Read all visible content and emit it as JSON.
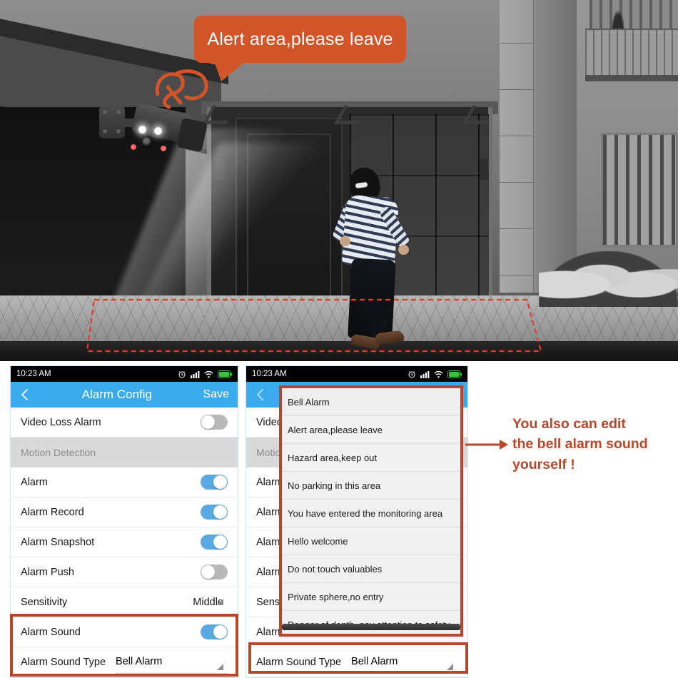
{
  "photo": {
    "speech_bubble": "Alert area,please leave",
    "scene_description": "security camera monitoring a house entrance with an intruder",
    "colors": {
      "bubble_bg": "#d2552a",
      "bubble_text": "#ffffff",
      "zone_line": "#e33a2a"
    },
    "icons": {
      "camera": "security-camera-icon",
      "doodle": "sound-wave-doodle-icon",
      "zone": "detection-zone-outline"
    }
  },
  "phone_left": {
    "statusbar": {
      "time": "10:23 AM",
      "icons": [
        "alarm-clock-icon",
        "signal-bars-icon",
        "wifi-icon",
        "battery-icon"
      ]
    },
    "navbar": {
      "back": "back-chevron-icon",
      "title": "Alarm Config",
      "save_label": "Save"
    },
    "rows": [
      {
        "type": "toggle",
        "label": "Video Loss Alarm",
        "value": "off"
      },
      {
        "type": "group",
        "label": "Motion Detection"
      },
      {
        "type": "toggle",
        "label": "Alarm",
        "value": "on"
      },
      {
        "type": "toggle",
        "label": "Alarm Record",
        "value": "on"
      },
      {
        "type": "toggle",
        "label": "Alarm Snapshot",
        "value": "on"
      },
      {
        "type": "toggle",
        "label": "Alarm Push",
        "value": "off"
      },
      {
        "type": "picker",
        "label": "Sensitivity",
        "value": "Middle"
      },
      {
        "type": "toggle",
        "label": "Alarm Sound",
        "value": "on"
      },
      {
        "type": "picker",
        "label": "Alarm Sound Type",
        "value": "Bell Alarm"
      }
    ]
  },
  "phone_right": {
    "statusbar": {
      "time": "10:23 AM",
      "icons": [
        "alarm-clock-icon",
        "signal-bars-icon",
        "wifi-icon",
        "battery-icon"
      ]
    },
    "navbar": {
      "back": "back-chevron-icon",
      "title": "Alarm Config",
      "save_label": "Save"
    },
    "rows": [
      {
        "type": "toggle",
        "label": "Video",
        "value": "off"
      },
      {
        "type": "group",
        "label": "Motion"
      },
      {
        "type": "toggle",
        "label": "Alarm",
        "value": "on"
      },
      {
        "type": "toggle",
        "label": "Alarm",
        "value": "on"
      },
      {
        "type": "toggle",
        "label": "Alarm",
        "value": "on"
      },
      {
        "type": "toggle",
        "label": "Alarm",
        "value": "off"
      },
      {
        "type": "picker",
        "label": "Sensit",
        "value": ""
      },
      {
        "type": "toggle",
        "label": "Alarm",
        "value": "on"
      }
    ],
    "bottom_field": {
      "label": "Alarm Sound Type",
      "value": "Bell Alarm"
    },
    "dropdown": {
      "selected": "Bell Alarm",
      "options": [
        "Bell Alarm",
        "Alert area,please leave",
        "Hazard area,keep out",
        "No parking in this area",
        "You have entered the monitoring area",
        "Hello welcome",
        "Do not touch valuables",
        "Private sphere,no entry",
        "Danger of depth, pay attention to safety"
      ]
    }
  },
  "annotation": {
    "line1": "You also can edit",
    "line2": "the bell alarm sound",
    "line3": "yourself !",
    "color": "#b6472a",
    "arrow_icon": "right-arrow-icon"
  }
}
